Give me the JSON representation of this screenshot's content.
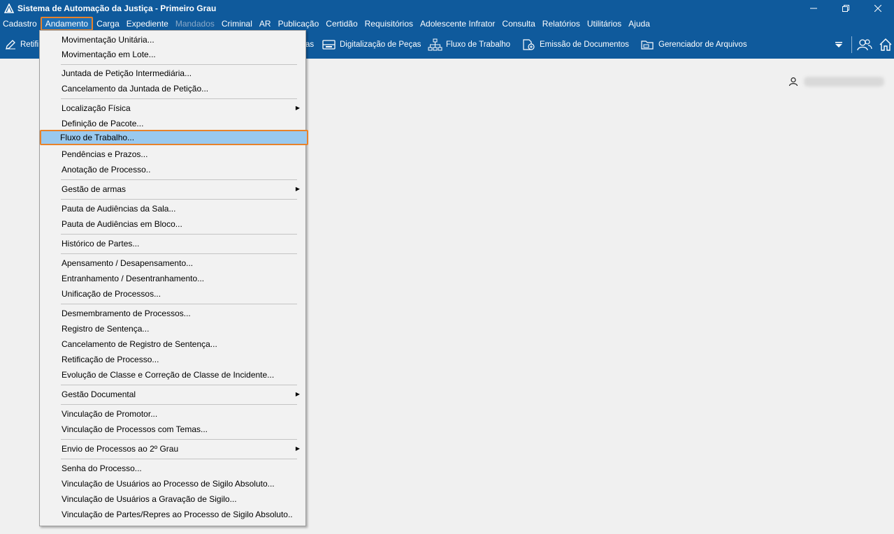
{
  "window": {
    "title": "Sistema de Automação da Justiça - Primeiro Grau",
    "minimize": "—",
    "restore": "❐",
    "close": "✕"
  },
  "menubar": {
    "items": [
      {
        "label": "Cadastro"
      },
      {
        "label": "Andamento"
      },
      {
        "label": "Carga"
      },
      {
        "label": "Expediente"
      },
      {
        "label": "Mandados"
      },
      {
        "label": "Criminal"
      },
      {
        "label": "AR"
      },
      {
        "label": "Publicação"
      },
      {
        "label": "Certidão"
      },
      {
        "label": "Requisitórios"
      },
      {
        "label": "Adolescente Infrator"
      },
      {
        "label": "Consulta"
      },
      {
        "label": "Relatórios"
      },
      {
        "label": "Utilitários"
      },
      {
        "label": "Ajuda"
      }
    ]
  },
  "toolbar": {
    "items": [
      {
        "label": "Retifi",
        "icon": "pencil-icon"
      },
      {
        "label": "as",
        "icon": ""
      },
      {
        "label": "Digitalização de Peças",
        "icon": "scanner-icon"
      },
      {
        "label": "Fluxo de Trabalho",
        "icon": "workflow-icon"
      },
      {
        "label": "Emissão de Documentos",
        "icon": "document-icon"
      },
      {
        "label": "Gerenciador de Arquivos",
        "icon": "folder-icon"
      }
    ]
  },
  "dropdown": {
    "items": [
      {
        "label": "Movimentação Unitária..."
      },
      {
        "label": "Movimentação em Lote..."
      },
      {
        "label": "Juntada de Petição Intermediária..."
      },
      {
        "label": "Cancelamento da Juntada de Petição..."
      },
      {
        "label": "Localização Física"
      },
      {
        "label": "Definição de Pacote..."
      },
      {
        "label": "Fluxo de Trabalho..."
      },
      {
        "label": "Pendências e Prazos..."
      },
      {
        "label": "Anotação de Processo.."
      },
      {
        "label": "Gestão de armas"
      },
      {
        "label": "Pauta de Audiências da Sala..."
      },
      {
        "label": "Pauta de Audiências em Bloco..."
      },
      {
        "label": "Histórico de Partes..."
      },
      {
        "label": "Apensamento / Desapensamento..."
      },
      {
        "label": "Entranhamento / Desentranhamento..."
      },
      {
        "label": "Unificação de Processos..."
      },
      {
        "label": "Desmembramento de Processos..."
      },
      {
        "label": "Registro de Sentença..."
      },
      {
        "label": "Cancelamento de Registro de Sentença..."
      },
      {
        "label": "Retificação de Processo..."
      },
      {
        "label": "Evolução de Classe e Correção de Classe de Incidente..."
      },
      {
        "label": "Gestão Documental"
      },
      {
        "label": "Vinculação de Promotor..."
      },
      {
        "label": "Vinculação de Processos com Temas..."
      },
      {
        "label": "Envio de Processos ao 2º Grau"
      },
      {
        "label": "Senha do Processo..."
      },
      {
        "label": "Vinculação de Usuários ao Processo de Sigilo Absoluto..."
      },
      {
        "label": "Vinculação de Usuários a Gravação de Sigilo..."
      },
      {
        "label": "Vinculação de Partes/Repres ao Processo de Sigilo Absoluto.."
      }
    ]
  },
  "colors": {
    "titlebar": "#0f5a9c",
    "highlight": "#99c9ef",
    "focus_border": "#e8822a"
  }
}
